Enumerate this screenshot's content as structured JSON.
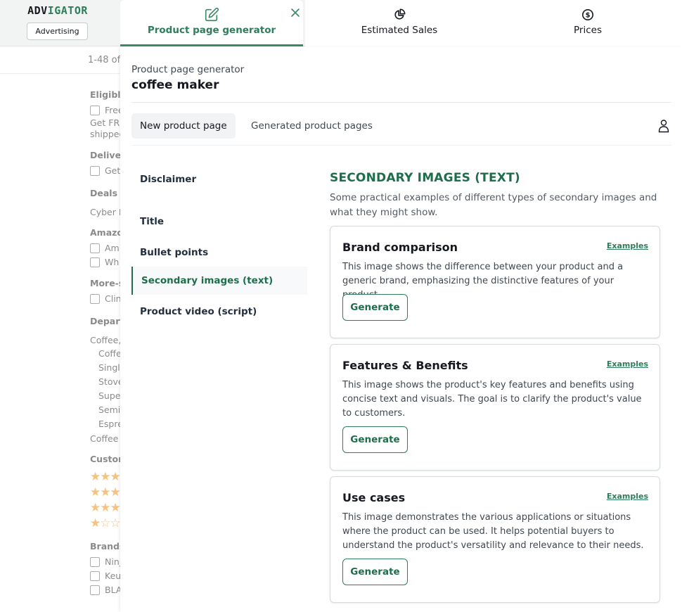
{
  "brand": {
    "logo_part1": "ADV",
    "logo_part2": "IGATOR",
    "button": "Advertising"
  },
  "colors": {
    "accent": "#1f6e4b",
    "accent_light": "#3b8a66",
    "star": "#f3a847"
  },
  "tabs": [
    {
      "label": "Product page generator",
      "icon": "edit-icon",
      "active": true,
      "closable": true
    },
    {
      "label": "Estimated Sales",
      "icon": "pie-chart-icon",
      "active": false
    },
    {
      "label": "Prices",
      "icon": "dollar-circle-icon",
      "active": false
    }
  ],
  "background_page": {
    "results_count": "1-48 of",
    "facets": {
      "eligible_heading": "Eligibl",
      "eligible_option": "Free",
      "eligible_note_1": "Get FR",
      "eligible_note_2": "shipped",
      "delivery_heading": "Deliver",
      "delivery_option": "Get",
      "deals_heading": "Deals &",
      "deals_option": "Cyber I",
      "amazon_heading": "Amazo",
      "amazon_option_1": "Am",
      "amazon_option_2": "Wh",
      "more_heading": "More-s",
      "more_option": "Clin",
      "dept_heading": "Depart",
      "dept_items": [
        "Coffee,",
        "Coffe",
        "Singl",
        "Stove",
        "Supe",
        "Semi",
        "Espre",
        "Coffee"
      ],
      "customer_heading": "Custon",
      "ratings": [
        "★★★",
        "★★★",
        "★★★",
        "★☆☆"
      ],
      "brands_heading": "Brands",
      "brands": [
        "Ninj",
        "Keu",
        "BLA"
      ]
    }
  },
  "panel": {
    "subtitle": "Product page generator",
    "title": "coffee maker",
    "subtabs": {
      "new": "New product page",
      "generated": "Generated product pages"
    },
    "nav": {
      "items": [
        {
          "label": "Disclaimer",
          "active": false
        },
        {
          "label": "Title",
          "active": false
        },
        {
          "label": "Bullet points",
          "active": false
        },
        {
          "label": "Secondary images (text)",
          "active": true
        },
        {
          "label": "Product video (script)",
          "active": false
        }
      ]
    },
    "section": {
      "heading": "SECONDARY IMAGES (TEXT)",
      "description": "Some practical examples of different types of secondary images and what they might show."
    },
    "cards": [
      {
        "title": "Brand comparison",
        "examples": "Examples",
        "text": "This image shows the difference between your product and a generic brand, emphasizing the distinctive features of your product.",
        "button": "Generate"
      },
      {
        "title": "Features & Benefits",
        "examples": "Examples",
        "text": "This image shows the product's key features and benefits using concise text and visuals. The goal is to clarify the product's value to customers.",
        "button": "Generate"
      },
      {
        "title": "Use cases",
        "examples": "Examples",
        "text": "This image demonstrates the various applications or situations where the product can be used. It helps potential buyers to understand the product's versatility and relevance to their needs.",
        "button": "Generate"
      }
    ]
  }
}
